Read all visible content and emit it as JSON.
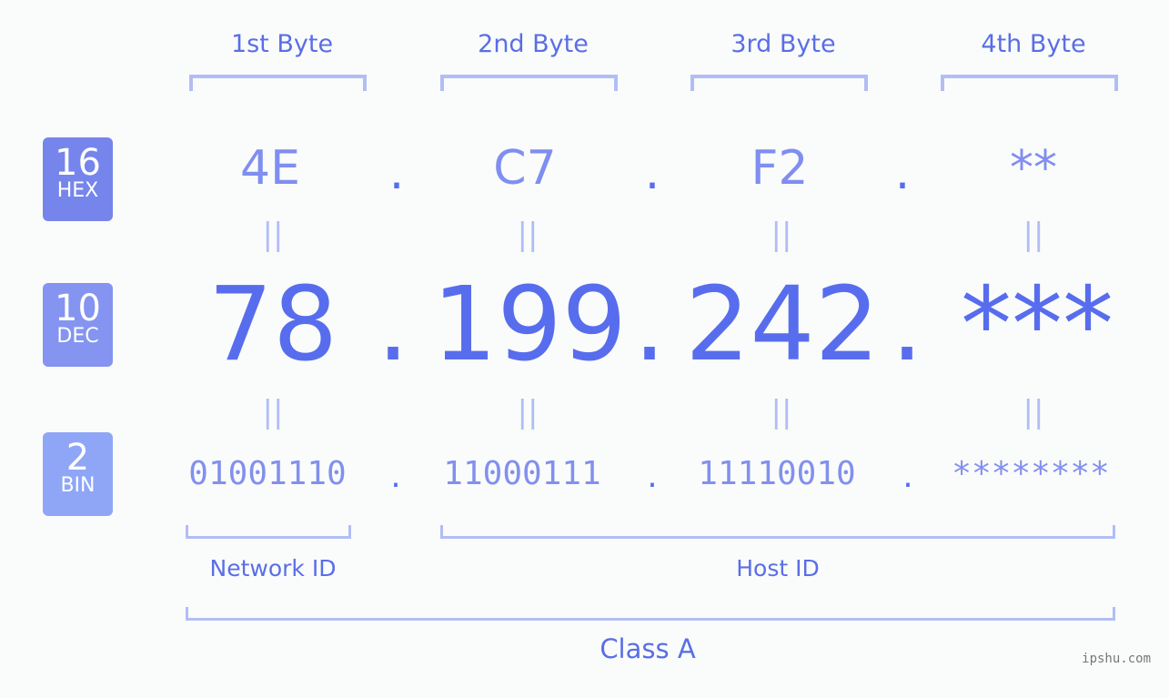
{
  "bytes": [
    {
      "header": "1st Byte",
      "hex": "4E",
      "dec": "78",
      "bin": "01001110"
    },
    {
      "header": "2nd Byte",
      "hex": "C7",
      "dec": "199",
      "bin": "11000111"
    },
    {
      "header": "3rd Byte",
      "hex": "F2",
      "dec": "242",
      "bin": "11110010"
    },
    {
      "header": "4th Byte",
      "hex": "**",
      "dec": "***",
      "bin": "********"
    }
  ],
  "badges": {
    "hex": {
      "num": "16",
      "label": "HEX",
      "color": "#7585ec"
    },
    "dec": {
      "num": "10",
      "label": "DEC",
      "color": "#8494f0"
    },
    "bin": {
      "num": "2",
      "label": "BIN",
      "color": "#8fa6f7"
    }
  },
  "separator": ".",
  "equals": "||",
  "labels": {
    "network_id": "Network ID",
    "host_id": "Host ID",
    "class": "Class A"
  },
  "watermark": "ipshu.com"
}
